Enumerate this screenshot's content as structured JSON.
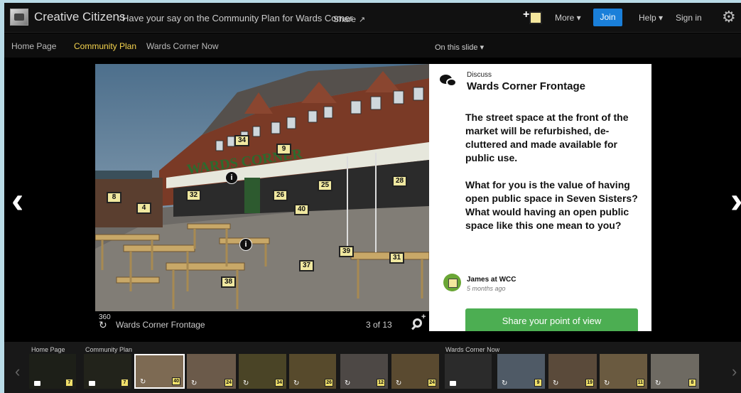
{
  "header": {
    "app_title": "Creative Citizens",
    "separator": ":",
    "subtitle": "Have your say on the Community Plan for Wards Corner",
    "share_label": "Share",
    "add_note_label": "+",
    "more_label": "More ▾",
    "join_label": "Join",
    "help_label": "Help ▾",
    "signin_label": "Sign in",
    "join_color": "#1a7fd9"
  },
  "nav": {
    "items": [
      {
        "label": "Home Page"
      },
      {
        "label": "Community Plan"
      },
      {
        "label": "Wards Corner Now"
      }
    ],
    "active_index": 1,
    "on_this_slide": "On this slide ▾",
    "active_color": "#f5d44e"
  },
  "scene": {
    "signage": "WARDS CORNER",
    "pins": [
      "34",
      "9",
      "28",
      "25",
      "26",
      "8",
      "32",
      "4",
      "40",
      "39",
      "31",
      "37",
      "38"
    ],
    "info_marker": "i",
    "rotate_label": "360",
    "caption": "Wards Corner Frontage",
    "counter": "3 of 13"
  },
  "panel": {
    "kind": "Discuss",
    "title": "Wards Corner Frontage",
    "paragraph1": "The street space at the front of the market will be refurbished, de-cluttered and made available for public use.",
    "paragraph2": "What for you is the value of having open public space in Seven Sisters? What would having an open public space like this one mean to you?",
    "author": "James at WCC",
    "time": "5 months ago",
    "share_button": "Share your point of view",
    "share_button_color": "#4cae52"
  },
  "filmstrip": {
    "sections": [
      "Home Page",
      "Community Plan",
      "Wards Corner Now"
    ],
    "thumbs": [
      {
        "count": "7",
        "icon": "camera"
      },
      {
        "count": "7",
        "icon": "camera"
      },
      {
        "count": "40",
        "icon": "rotate",
        "selected": true
      },
      {
        "count": "24",
        "icon": "rotate"
      },
      {
        "count": "34",
        "icon": "rotate"
      },
      {
        "count": "26",
        "icon": "rotate"
      },
      {
        "count": "12",
        "icon": "rotate"
      },
      {
        "count": "24",
        "icon": "rotate"
      },
      {
        "count": "",
        "icon": "camera"
      },
      {
        "count": "9",
        "icon": "rotate"
      },
      {
        "count": "19",
        "icon": "rotate"
      },
      {
        "count": "11",
        "icon": "rotate"
      },
      {
        "count": "8",
        "icon": "rotate"
      }
    ]
  }
}
